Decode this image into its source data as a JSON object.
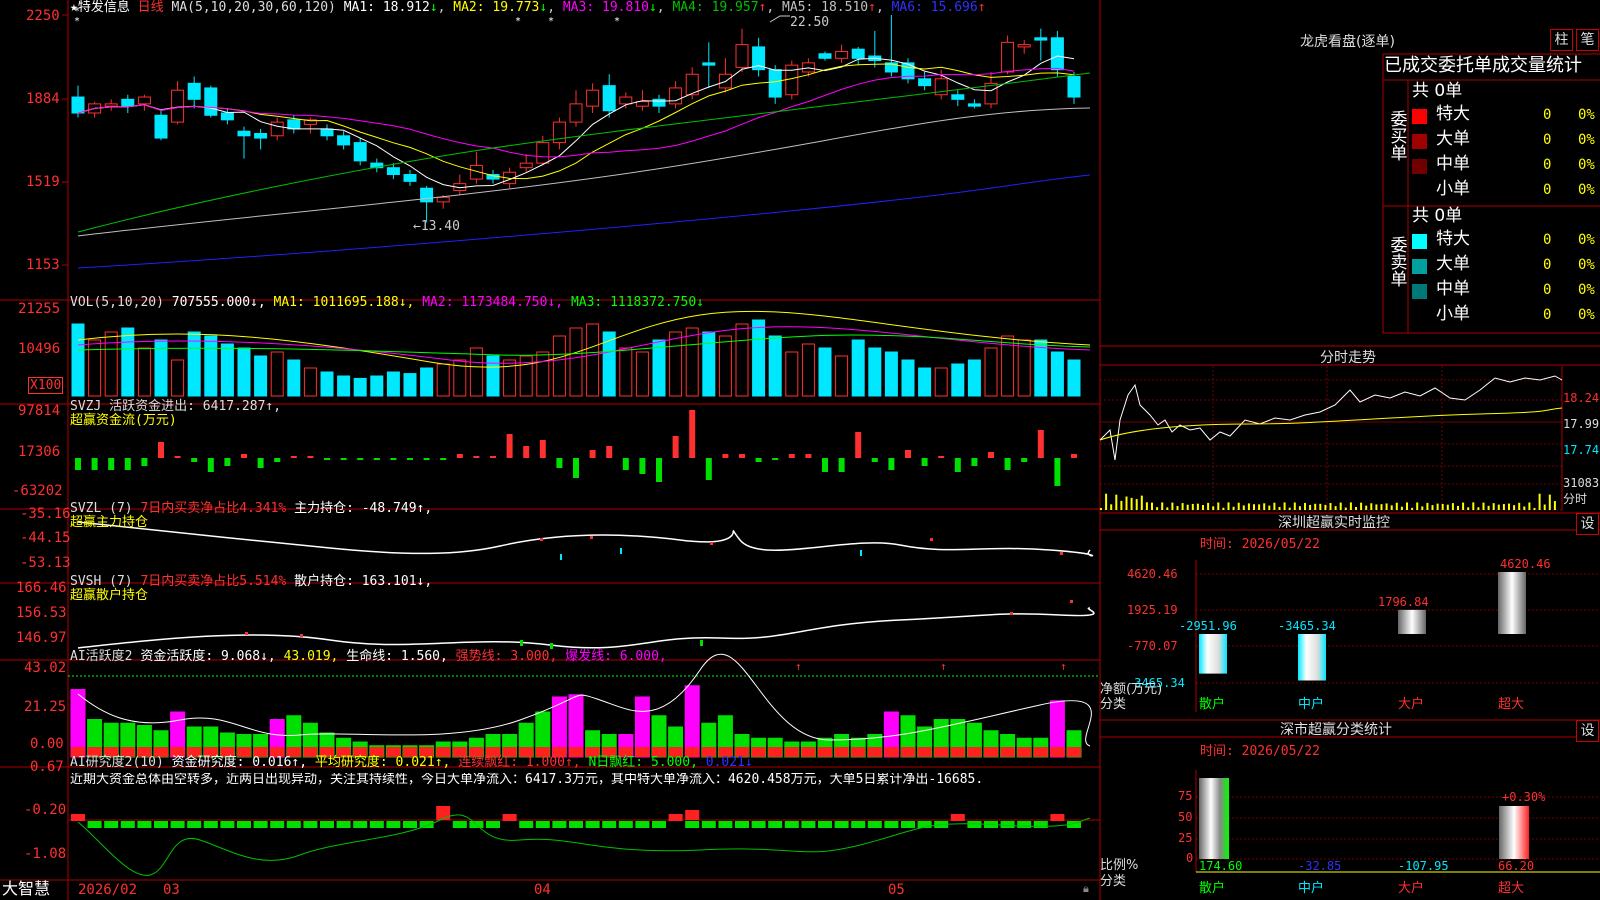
{
  "colors": {
    "up": "#ff3030",
    "down": "#00e8ff",
    "ma1": "#ffffff",
    "ma2": "#ffff00",
    "ma3": "#ff00ff",
    "ma4": "#00c000",
    "ma5": "#c0c0c0",
    "ma6": "#2020ff",
    "grid": "#a00000"
  },
  "main": {
    "stock_name": "★特发信息",
    "period": "日线",
    "ma_title": "MA(5,10,20,30,60,120)",
    "ma": [
      {
        "label": "MA1: 18.912",
        "arrow": "↓"
      },
      {
        "label": "MA2: 19.773",
        "arrow": "↓"
      },
      {
        "label": "MA3: 19.810",
        "arrow": "↓"
      },
      {
        "label": "MA4: 19.957",
        "arrow": "↑"
      },
      {
        "label": "MA5: 18.510",
        "arrow": "↑"
      },
      {
        "label": "MA6: 15.696",
        "arrow": "↑"
      }
    ],
    "y_ticks": [
      "2250",
      "1884",
      "1519",
      "1153"
    ],
    "high_label": "22.50",
    "low_label": "←13.40"
  },
  "vol": {
    "title": "VOL(5,10,20)",
    "value": "707555.000↓,",
    "ma1": "MA1: 1011695.188↓,",
    "ma2": "MA2: 1173484.750↓,",
    "ma3": "MA3: 1118372.750↓",
    "y_ticks": [
      "21255",
      "10496"
    ],
    "unit": "X100"
  },
  "svzj": {
    "title": "SVZJ  活跃资金进出: 6417.287↑,",
    "subtitle": "超赢资金流(万元)",
    "y_ticks": [
      "97814",
      "17306",
      "-63202"
    ]
  },
  "svzl": {
    "title": "SVZL (7)",
    "ratio": "7日内买卖净占比4.341%",
    "holding": "主力持仓: -48.749↑,",
    "subtitle": "超赢主力持仓",
    "y_ticks": [
      "-35.16",
      "-44.15",
      "-53.13"
    ]
  },
  "svsh": {
    "title": "SVSH (7)",
    "ratio": "7日内买卖净占比5.514%",
    "holding": "散户持仓: 163.101↓,",
    "subtitle": "超赢散户持仓",
    "y_ticks": [
      "166.46",
      "156.53",
      "146.97"
    ]
  },
  "ai2": {
    "title": "AI活跃度2",
    "activity": "资金活跃度: 9.068↓,",
    "v43": "43.019,",
    "life": "生命线: 1.560,",
    "strong": "强势线: 3.000,",
    "burst": "爆发线: 6.000,",
    "y_ticks": [
      "43.02",
      "21.25",
      "0.00"
    ]
  },
  "ai_research": {
    "title": "AI研究度2(10)",
    "research": "资金研究度: 0.016↑,",
    "avg": "平均研究度: 0.021↑,",
    "consec": "连续飘红: 1.000↑,",
    "nday": "N日飘红: 5.000,",
    "last": "0.021↓",
    "comment": "近期大资金总体由空转多，近两日出现异动，关注其持续性，今日大单净流入：6417.3万元，其中特大单净流入：4620.458万元，大单5日累计净出-16685.",
    "y_ticks": [
      "0.67",
      "-0.20",
      "-1.08"
    ]
  },
  "bottom": {
    "brand": "大智慧",
    "dates": [
      "2026/02",
      "03",
      "04",
      "05"
    ]
  },
  "dragon": {
    "title": "龙虎看盘(逐单)",
    "btn_bar": "柱",
    "btn_pen": "笔",
    "header": "已成交委托单成交量统计",
    "buy_side": "委买单",
    "sell_side": "委卖单",
    "buy": {
      "total": "共 0单",
      "rows": [
        {
          "label": "特大",
          "count": "0",
          "pct": "0%",
          "color": "#ff0000"
        },
        {
          "label": "大单",
          "count": "0",
          "pct": "0%",
          "color": "#a00000"
        },
        {
          "label": "中单",
          "count": "0",
          "pct": "0%",
          "color": "#700000"
        },
        {
          "label": "小单",
          "count": "0",
          "pct": "0%",
          "color": "#000000"
        }
      ]
    },
    "sell": {
      "total": "共 0单",
      "rows": [
        {
          "label": "特大",
          "count": "0",
          "pct": "0%",
          "color": "#00ffff"
        },
        {
          "label": "大单",
          "count": "0",
          "pct": "0%",
          "color": "#00a0a0"
        },
        {
          "label": "中单",
          "count": "0",
          "pct": "0%",
          "color": "#007878"
        },
        {
          "label": "小单",
          "count": "0",
          "pct": "0%",
          "color": "#000000"
        }
      ]
    }
  },
  "fenshi": {
    "title": "分时走势",
    "prices": [
      "18.24",
      "17.99",
      "17.74"
    ],
    "vol_label": "31083",
    "unit": "分时"
  },
  "monitor": {
    "title": "深圳超赢实时监控",
    "btn": "设",
    "time": "时间: 2026/05/22",
    "y_ticks": [
      "4620.46",
      "1925.19",
      "-770.07",
      "-3465.34"
    ],
    "axis_label": "净额(万元)",
    "cat_label": "分类",
    "categories": [
      "散户",
      "中户",
      "大户",
      "超大"
    ],
    "values": [
      -2951.96,
      -3465.34,
      1796.84,
      4620.46
    ],
    "value_labels": [
      "-2951.96",
      "-3465.34",
      "1796.84",
      "4620.46"
    ]
  },
  "classify": {
    "title": "深市超赢分类统计",
    "btn": "设",
    "time": "时间: 2026/05/22",
    "y_ticks": [
      "75",
      "50",
      "25",
      "0"
    ],
    "axis_label": "比例%",
    "cat_label": "分类",
    "categories": [
      "散户",
      "中户",
      "大户",
      "超大"
    ],
    "values": [
      "174.60",
      "-32.85",
      "-107.95",
      "66.20"
    ],
    "change": "+0.30%"
  }
}
